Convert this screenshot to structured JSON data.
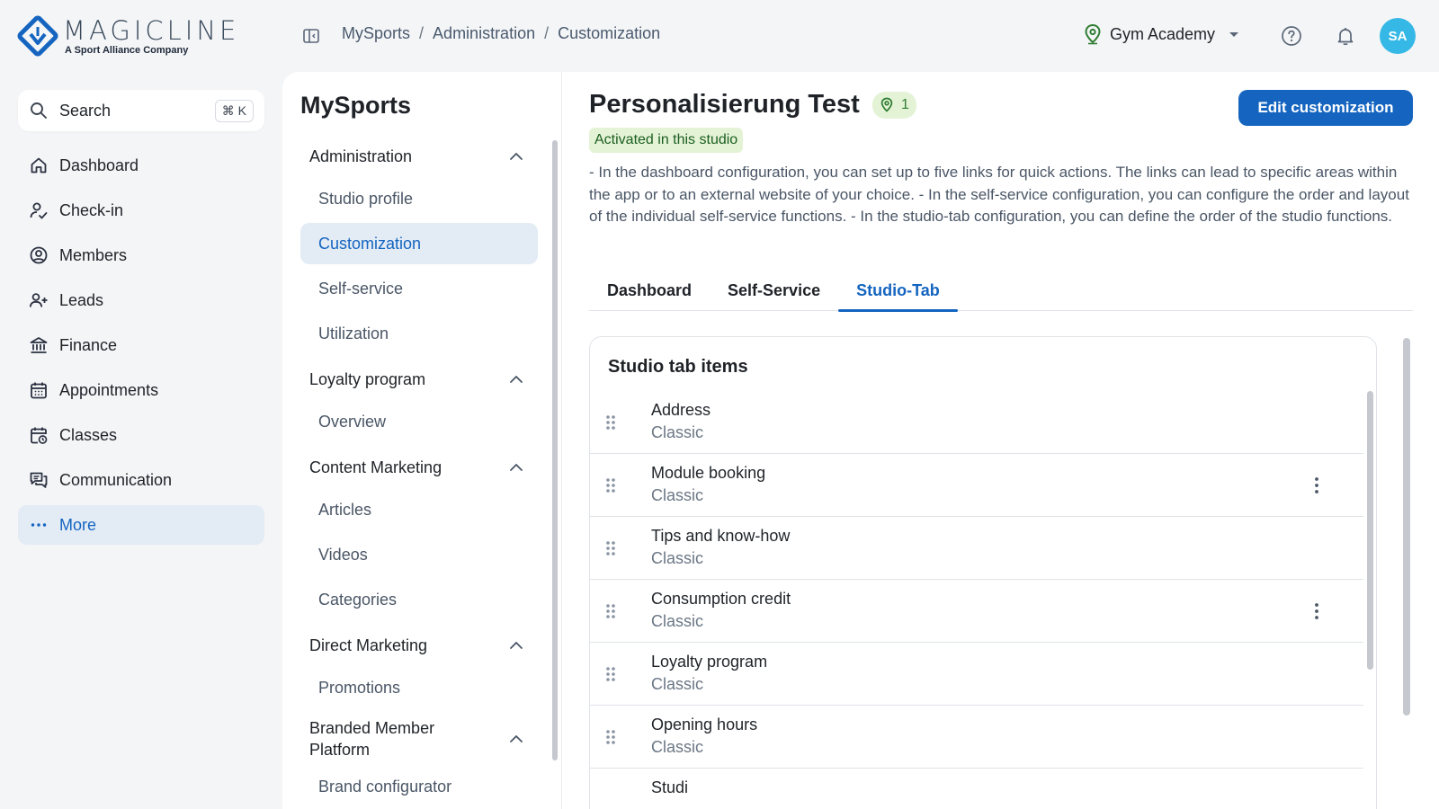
{
  "brand": {
    "name": "MAGICLINE",
    "tagline": "A Sport Alliance Company",
    "color": "#1565c0"
  },
  "breadcrumb": [
    "MySports",
    "Administration",
    "Customization"
  ],
  "studio": {
    "name": "Gym Academy"
  },
  "user": {
    "initials": "SA"
  },
  "search": {
    "label": "Search",
    "shortcut": "⌘ K"
  },
  "nav": {
    "items": [
      {
        "label": "Dashboard",
        "icon": "home-icon"
      },
      {
        "label": "Check-in",
        "icon": "person-check-icon"
      },
      {
        "label": "Members",
        "icon": "user-circle-icon"
      },
      {
        "label": "Leads",
        "icon": "person-add-icon"
      },
      {
        "label": "Finance",
        "icon": "bank-icon"
      },
      {
        "label": "Appointments",
        "icon": "calendar-icon"
      },
      {
        "label": "Classes",
        "icon": "calendar-clock-icon"
      },
      {
        "label": "Communication",
        "icon": "chat-icon"
      },
      {
        "label": "More",
        "icon": "more-dots-icon",
        "active": true
      }
    ]
  },
  "subnav": {
    "title": "MySports",
    "sections": [
      {
        "label": "Administration",
        "items": [
          "Studio profile",
          "Customization",
          "Self-service",
          "Utilization"
        ]
      },
      {
        "label": "Loyalty program",
        "items": [
          "Overview"
        ]
      },
      {
        "label": "Content Marketing",
        "items": [
          "Articles",
          "Videos",
          "Categories"
        ]
      },
      {
        "label": "Direct Marketing",
        "items": [
          "Promotions"
        ]
      },
      {
        "label": "Branded Member Platform",
        "items": [
          "Brand configurator"
        ]
      }
    ],
    "active_item": "Customization"
  },
  "main": {
    "title": "Personalisierung Test",
    "location_count": "1",
    "status": "Activated in this studio",
    "edit_button": "Edit customization",
    "description": "- In the dashboard configuration, you can set up to five links for quick actions. The links can lead to specific areas within the app or to an external website of your choice. - In the self-service configuration, you can configure the order and layout of the individual self-service functions. - In the studio-tab configuration, you can define the order of the studio functions.",
    "tabs": [
      {
        "label": "Dashboard",
        "active": false
      },
      {
        "label": "Self-Service",
        "active": false
      },
      {
        "label": "Studio-Tab",
        "active": true
      }
    ],
    "card": {
      "title": "Studio tab items",
      "rows": [
        {
          "title": "Address",
          "sub": "Classic",
          "menu": false
        },
        {
          "title": "Module booking",
          "sub": "Classic",
          "menu": true
        },
        {
          "title": "Tips and know-how",
          "sub": "Classic",
          "menu": false
        },
        {
          "title": "Consumption credit",
          "sub": "Classic",
          "menu": true
        },
        {
          "title": "Loyalty program",
          "sub": "Classic",
          "menu": false
        },
        {
          "title": "Opening hours",
          "sub": "Classic",
          "menu": false
        },
        {
          "title": "Studi",
          "sub": "",
          "menu": false
        }
      ]
    }
  }
}
